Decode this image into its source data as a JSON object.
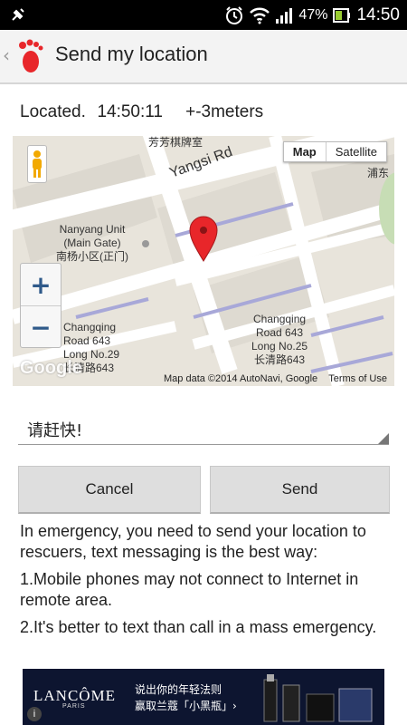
{
  "status_bar": {
    "notification_icon": "usb-debug-icon",
    "icons": [
      "alarm-icon",
      "wifi-icon",
      "signal-icon",
      "battery-icon"
    ],
    "battery_percent": "47%",
    "time": "14:50"
  },
  "action_bar": {
    "back_icon": "chevron-left-icon",
    "app_icon": "footprint-icon",
    "title": "Send my location"
  },
  "located": "Located.  14:50:11    +-3meters",
  "map": {
    "type_buttons": [
      "Map",
      "Satellite"
    ],
    "selected_type": "Map",
    "zoom_in": "+",
    "zoom_out": "−",
    "logo": "Google",
    "attribution": "Map data ©2014 AutoNavi, Google    Terms of Use",
    "labels": {
      "street": "Yangsi Rd",
      "poi_top": "芳芳棋牌室",
      "nanyang": "Nanyang Unit\n(Main Gate)\n南杨小区(正门)",
      "changqing_left": "Changqing\nRoad 643\nLong No.29\n长清路643",
      "changqing_right": "Changqing\nRoad 643\nLong No.25\n长清路643",
      "pudong": "浦东"
    }
  },
  "message": {
    "value": "请赶快!"
  },
  "buttons": {
    "cancel": "Cancel",
    "send": "Send"
  },
  "info": {
    "p1": "In emergency, you need to send your location to rescuers, text messaging is the best way:",
    "p2": "1.Mobile phones may not connect to Internet in remote area.",
    "p3": "2.It's better to text than call in a mass emergency."
  },
  "ad": {
    "brand": "LANCÔME",
    "brand_sub": "PARIS",
    "line1": "说出你的年轻法则",
    "line2": "赢取兰蔻「小黑瓶」›",
    "info_icon": "i"
  },
  "colors": {
    "accent_red": "#e8262a",
    "status_bg": "#000000",
    "action_bar_bg": "#f3f3f3",
    "button_bg": "#dedede",
    "ad_bg": "#0d1530"
  }
}
